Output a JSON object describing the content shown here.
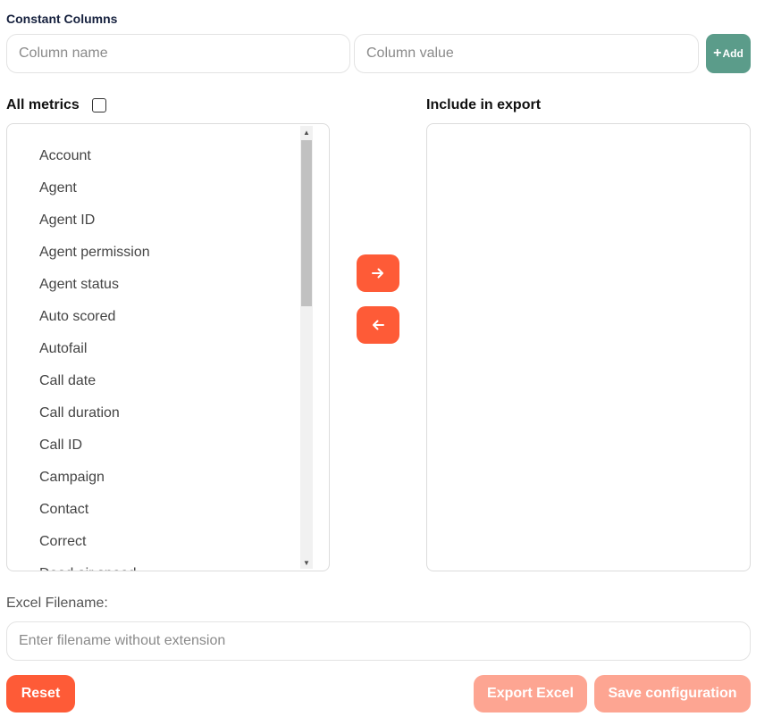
{
  "constant_columns": {
    "title": "Constant Columns",
    "column_name_placeholder": "Column name",
    "column_value_placeholder": "Column value",
    "add_label": "Add"
  },
  "all_metrics": {
    "heading": "All metrics",
    "select_all_checked": false,
    "items": [
      "Account",
      "Agent",
      "Agent ID",
      "Agent permission",
      "Agent status",
      "Auto scored",
      "Autofail",
      "Call date",
      "Call duration",
      "Call ID",
      "Campaign",
      "Contact",
      "Correct",
      "Dead air speed"
    ]
  },
  "include_in_export": {
    "heading": "Include in export",
    "items": []
  },
  "transfer": {
    "move_right_icon": "arrow-right-icon",
    "move_left_icon": "arrow-left-icon"
  },
  "filename": {
    "label": "Excel Filename:",
    "placeholder": "Enter filename without extension"
  },
  "actions": {
    "reset_label": "Reset",
    "export_label": "Export Excel",
    "save_label": "Save configuration"
  },
  "colors": {
    "accent": "#fe5b37",
    "accent_disabled": "#fda592",
    "add_button": "#5b9c8a"
  }
}
